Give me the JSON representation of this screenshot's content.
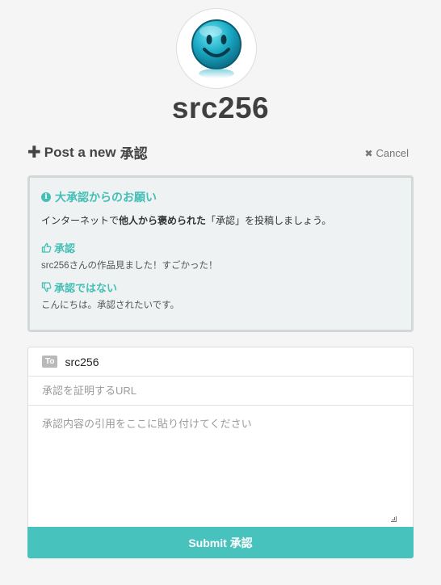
{
  "profile": {
    "username": "src256",
    "avatar_icon": "smiley-face-icon"
  },
  "header": {
    "title_prefix": "Post a new",
    "title_word": "承認",
    "cancel_label": "Cancel"
  },
  "info": {
    "title": "大承認からのお願い",
    "line_before": "インターネットで",
    "line_emph": "他人から褒められた",
    "line_after": "「承認」を投稿しましょう。",
    "good_title": "承認",
    "good_text": "src256さんの作品見ました！すごかった！",
    "bad_title": "承認ではない",
    "bad_text": "こんにちは。承認されたいです。"
  },
  "form": {
    "to_badge": "To",
    "to_value": "src256",
    "url_placeholder": "承認を証明するURL",
    "quote_placeholder": "承認内容の引用をここに貼り付けてください",
    "submit_label": "Submit 承認"
  },
  "colors": {
    "accent": "#48c2bd",
    "info_bg": "#eff2f2",
    "page_bg": "#f5f5f5"
  }
}
